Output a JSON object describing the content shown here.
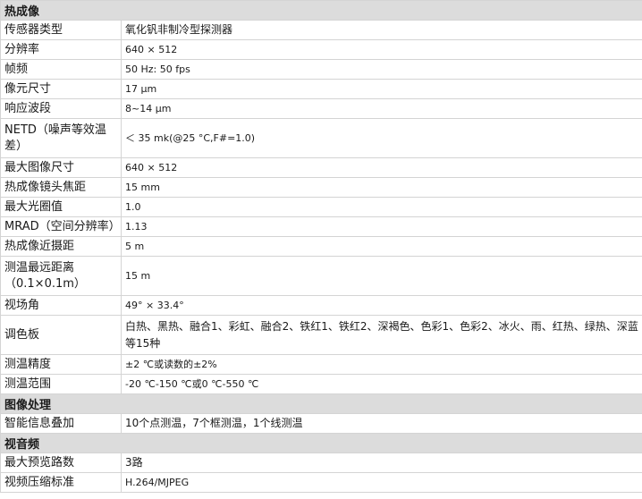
{
  "sections": {
    "thermal": "热成像",
    "image": "图像处理",
    "video": "视音频"
  },
  "rows": {
    "sensor_type": {
      "label": "传感器类型",
      "value": "氧化钒非制冷型探测器"
    },
    "resolution": {
      "label": "分辨率",
      "value": "640 × 512"
    },
    "frame_rate": {
      "label": "帧频",
      "value": "50 Hz: 50 fps"
    },
    "pixel_size": {
      "label": "像元尺寸",
      "value": "17 μm"
    },
    "band": {
      "label": "响应波段",
      "value": "8~14 μm"
    },
    "netd": {
      "label": "NETD（噪声等效温差）",
      "value": "＜ 35 mk(@25 °C,F#=1.0)"
    },
    "max_image_size": {
      "label": "最大图像尺寸",
      "value": "640 × 512"
    },
    "focal_length": {
      "label": "热成像镜头焦距",
      "value": "15 mm"
    },
    "max_aperture": {
      "label": "最大光圈值",
      "value": "1.0"
    },
    "mrad": {
      "label": "MRAD（空间分辨率）",
      "value": "1.13"
    },
    "min_focus": {
      "label": "热成像近摄距",
      "value": "5 m"
    },
    "max_measure_distance": {
      "label": "测温最远距离（0.1×0.1m）",
      "value": "15 m"
    },
    "fov": {
      "label": "视场角",
      "value": "49° × 33.4°"
    },
    "palette": {
      "label": "调色板",
      "value": "白热、黑热、融合1、彩虹、融合2、铁红1、铁红2、深褐色、色彩1、色彩2、冰火、雨、红热、绿热、深蓝等15种"
    },
    "accuracy": {
      "label": "测温精度",
      "value": "±2 ℃或读数的±2%"
    },
    "range": {
      "label": "测温范围",
      "value": "-20 ℃-150 ℃或0 ℃-550 ℃"
    },
    "overlay": {
      "label": "智能信息叠加",
      "value": "10个点测温，7个框测温，1个线测温"
    },
    "max_preview": {
      "label": "最大预览路数",
      "value": "3路"
    },
    "compression": {
      "label": "视频压缩标准",
      "value": "H.264/MJPEG"
    }
  }
}
